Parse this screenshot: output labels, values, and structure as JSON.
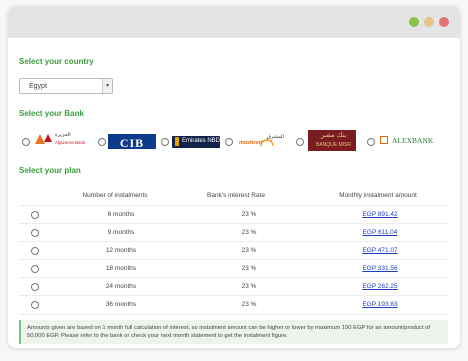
{
  "window": {
    "controls": [
      {
        "name": "green-dot",
        "color": "#8bc34a"
      },
      {
        "name": "yellow-dot",
        "color": "#e6c289"
      },
      {
        "name": "red-dot",
        "color": "#e57373"
      }
    ]
  },
  "country": {
    "heading": "Select your country",
    "selected": "Egypt"
  },
  "bank": {
    "heading": "Select your Bank",
    "banks": [
      {
        "id": "aljazeera",
        "text_ar": "الجزيرة",
        "text_en": "Aljazeera Bank"
      },
      {
        "id": "cib",
        "text": "CIB"
      },
      {
        "id": "emirates-nbd",
        "text": "Emirates NBD"
      },
      {
        "id": "mashreq",
        "text_ar": "المشرق",
        "text_en": "mashreq"
      },
      {
        "id": "banque-misr",
        "text_ar": "بنك مصر",
        "text_en": "BANQUE MISR"
      },
      {
        "id": "alexbank",
        "text": "ALEXBANK"
      }
    ]
  },
  "plan": {
    "heading": "Select your plan",
    "headers": [
      "Number of instalments",
      "Bank's interest Rate",
      "Monthly instalment amount"
    ],
    "rows": [
      {
        "months": "6 months",
        "rate": "23 %",
        "amount": "EGP 891.42"
      },
      {
        "months": "9 months",
        "rate": "23 %",
        "amount": "EGP 611.04"
      },
      {
        "months": "12 months",
        "rate": "23 %",
        "amount": "EGP 471.07"
      },
      {
        "months": "18 months",
        "rate": "23 %",
        "amount": "EGP 331.56"
      },
      {
        "months": "24 months",
        "rate": "23 %",
        "amount": "EGP 262.25"
      },
      {
        "months": "36 months",
        "rate": "23 %",
        "amount": "EGP 193.83"
      }
    ]
  },
  "note": "Amounts given are based on 1 month full calculation of interest, so instalment amount can be higher or lower by maximum 100 EGP for an amount/product of 50,000 EGP. Please refer to the bank or check your next month statement to get the instalment figure."
}
